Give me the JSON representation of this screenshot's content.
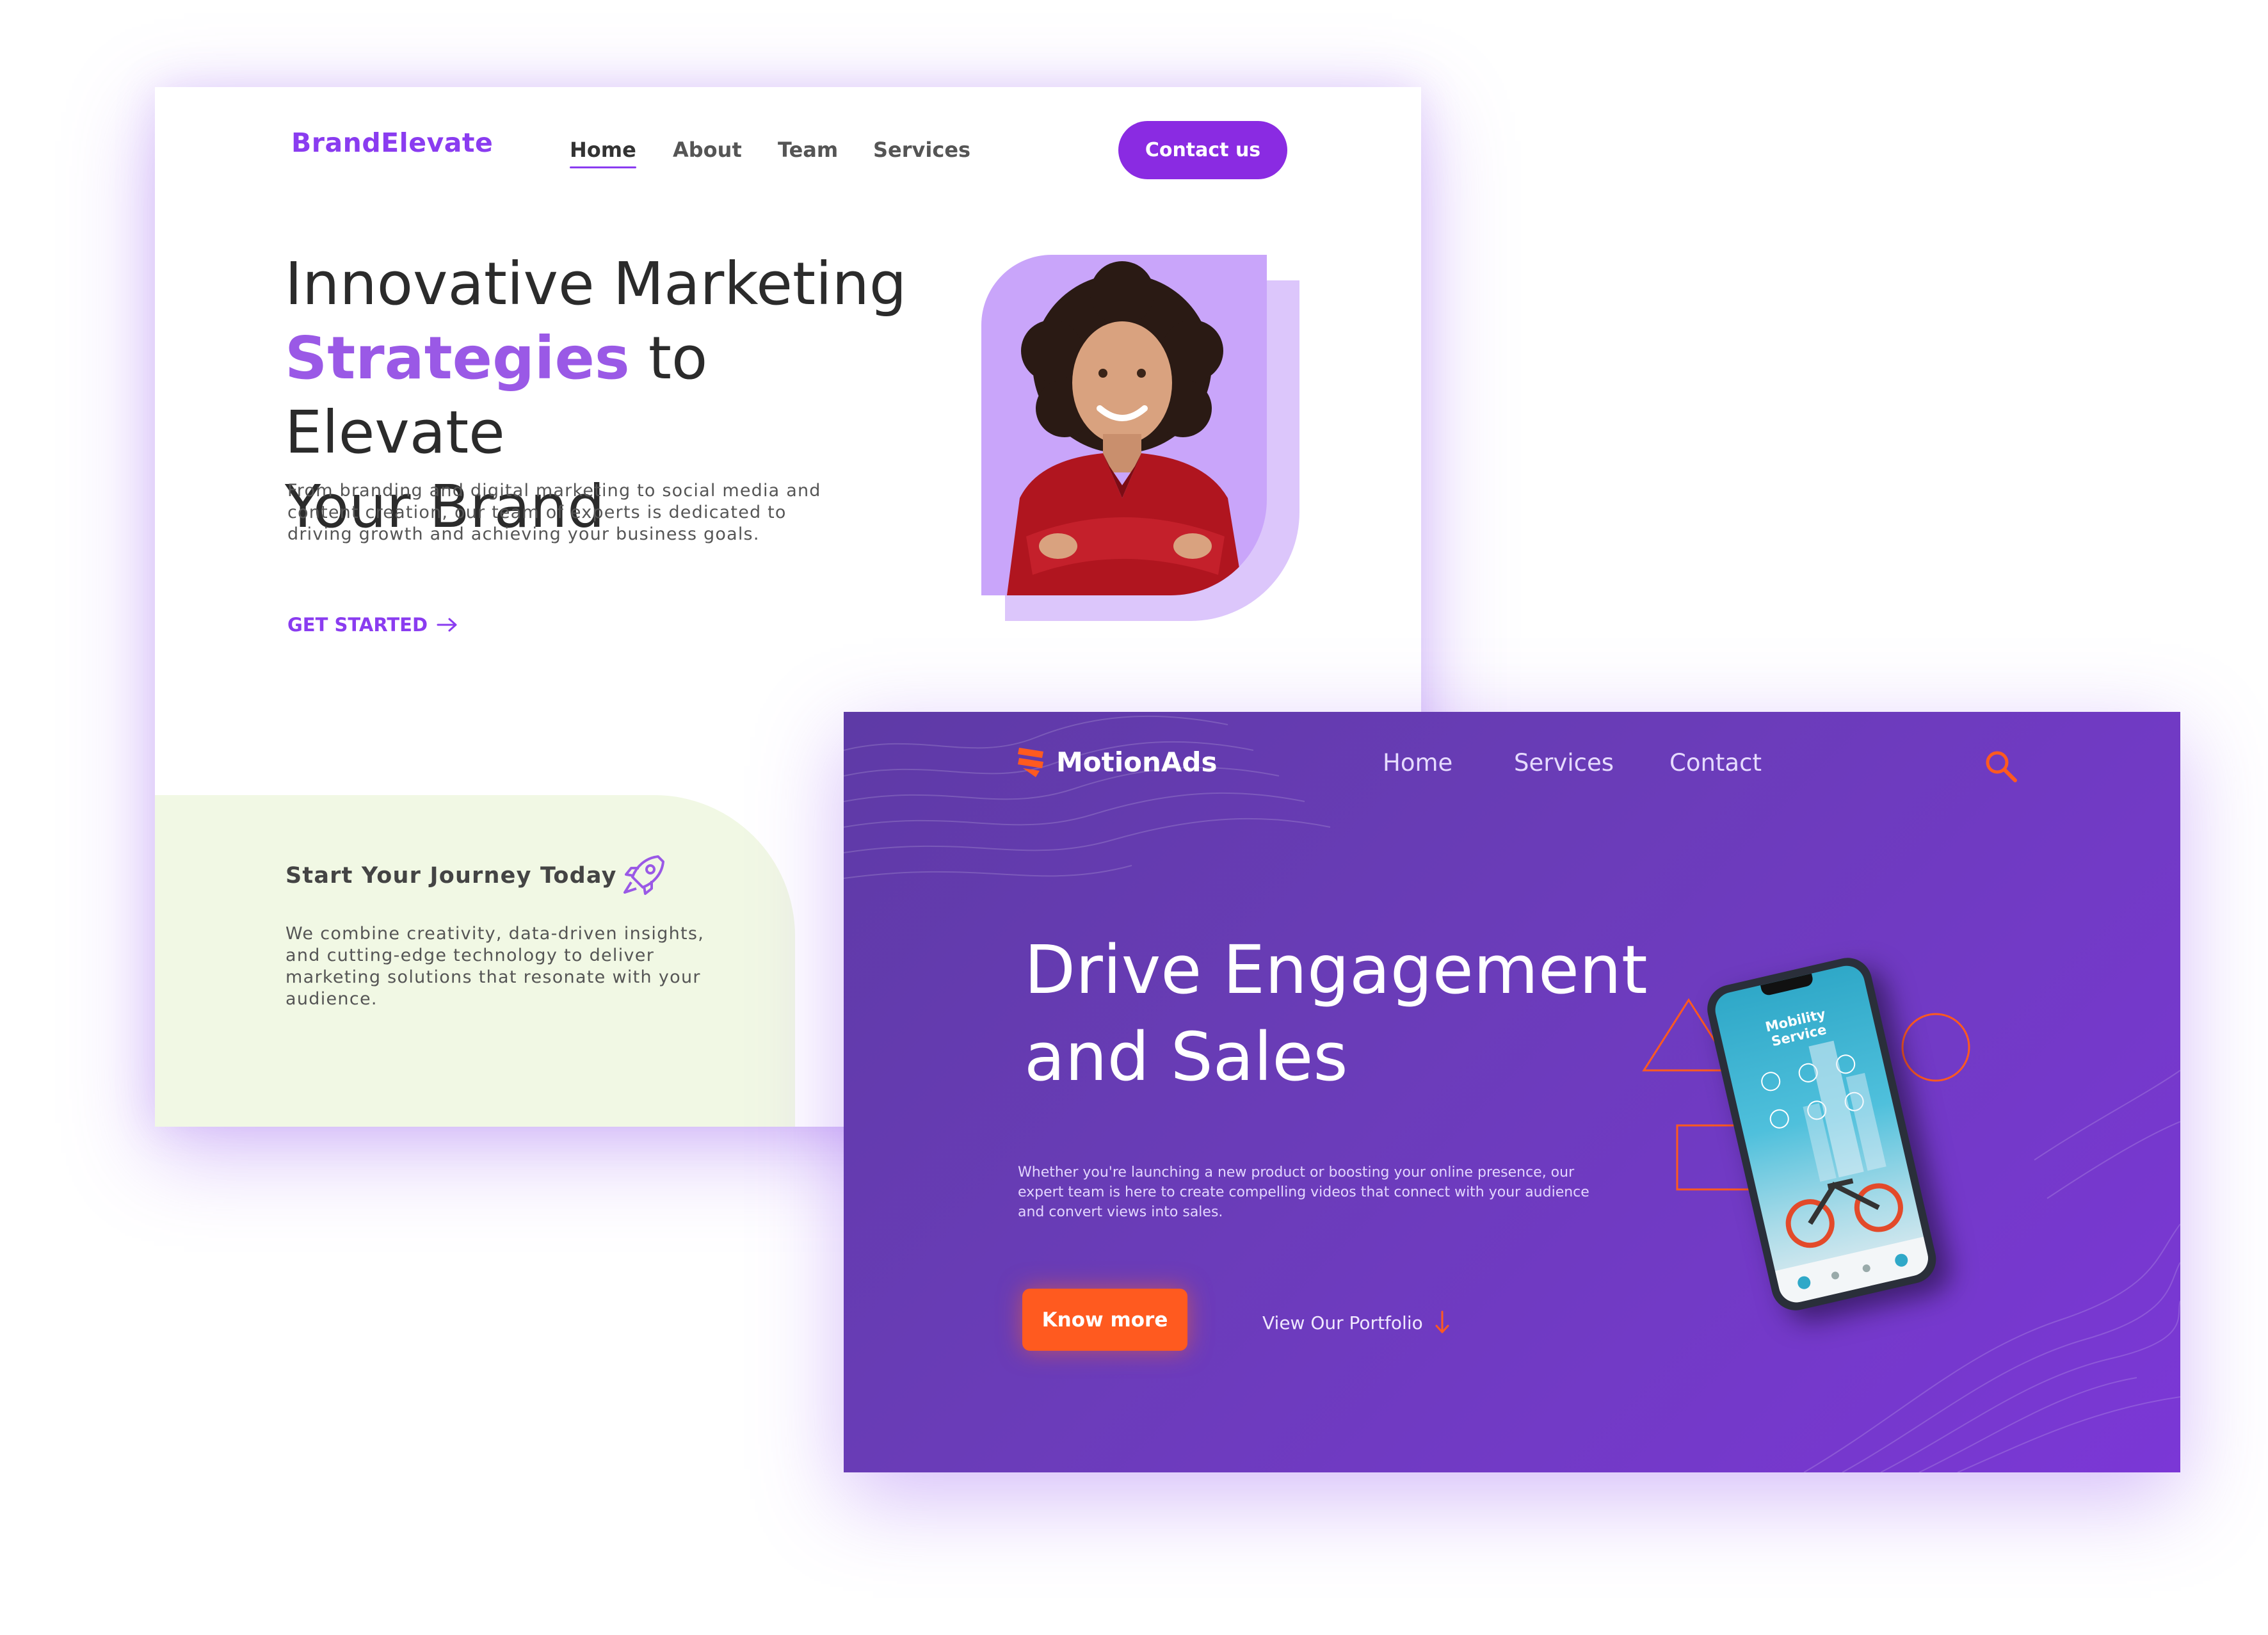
{
  "brandelevate": {
    "logo": "BrandElevate",
    "nav": [
      "Home",
      "About",
      "Team",
      "Services"
    ],
    "contact_button": "Contact us",
    "hero": {
      "line1": "Innovative Marketing",
      "highlight": "Strategies",
      "line2_rest": " to Elevate",
      "line3": "Your Brand"
    },
    "description": "From branding and digital marketing to social media and content creation, our team of experts is dedicated to driving growth and achieving your business goals.",
    "cta": "GET STARTED",
    "journey": {
      "title": "Start Your Journey Today",
      "description": "We combine creativity, data-driven insights, and cutting-edge technology to deliver marketing solutions that resonate with your audience."
    },
    "colors": {
      "accent": "#8a2be2",
      "photo_bg": "#c9a5fa",
      "journey_bg": "#f1f8e4"
    },
    "icons": [
      "arrow-right-icon",
      "rocket-icon"
    ]
  },
  "motionads": {
    "logo": "MotionAds",
    "nav": [
      "Home",
      "Services",
      "Contact"
    ],
    "hero_line1": "Drive Engagement",
    "hero_line2": "and Sales",
    "description": "Whether you're launching a new product or boosting your online presence, our expert team is here to create compelling videos that connect with your audience and convert views into sales.",
    "primary_button": "Know more",
    "secondary_link": "View Our Portfolio",
    "phone_app_title_1": "Mobility",
    "phone_app_title_2": "Service",
    "colors": {
      "background": "#6a3cb8",
      "accent": "#ff5a1f"
    },
    "icons": [
      "logo-stripes-icon",
      "search-icon",
      "arrow-down-icon",
      "triangle-shape",
      "circle-shape",
      "rectangle-shape"
    ]
  }
}
